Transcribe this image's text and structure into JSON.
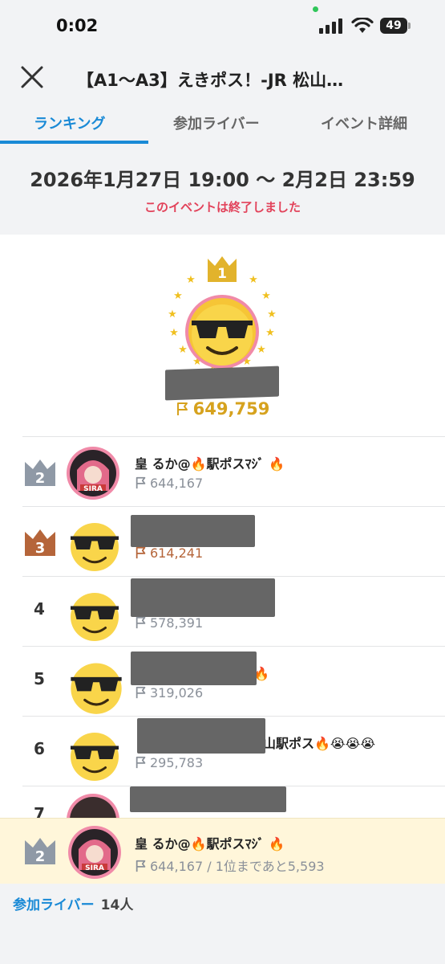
{
  "status_bar": {
    "time": "0:02",
    "battery": "49"
  },
  "header": {
    "title": "【A1〜A3】えきポス！-JR 松山…"
  },
  "tabs": [
    {
      "label": "ランキング"
    },
    {
      "label": "参加ライバー"
    },
    {
      "label": "イベント詳細"
    }
  ],
  "event": {
    "period": "2026年1月27日 19:00 〜 2月2日 23:59",
    "status": "このイベントは終了しました"
  },
  "top1": {
    "rank": "1",
    "score": "649,759"
  },
  "rows": [
    {
      "rank": "2",
      "name": "皇 るか@🔥駅ポスﾏｼﾞ 🔥",
      "score": "644,167"
    },
    {
      "rank": "3",
      "name": "",
      "score": "614,241"
    },
    {
      "rank": "4",
      "name": "",
      "score": "578,391"
    },
    {
      "rank": "5",
      "name": "ｶﾁ🔥",
      "score": "319,026"
    },
    {
      "rank": "6",
      "name": "山駅ポス🔥😭😭😭",
      "score": "295,783"
    },
    {
      "rank": "7",
      "name": "",
      "score": ""
    }
  ],
  "my_rank": {
    "rank": "2",
    "name": "皇 るか@🔥駅ポスﾏｼﾞ 🔥",
    "score_text": "644,167 / 1位まであと5,593"
  },
  "footer": {
    "label": "参加ライバー",
    "count": "14人"
  },
  "colors": {
    "accent": "#1a8ad6",
    "gold": "#d6a21e",
    "silver": "#8f99a6",
    "bronze": "#b5653a",
    "ended": "#e2425a"
  }
}
